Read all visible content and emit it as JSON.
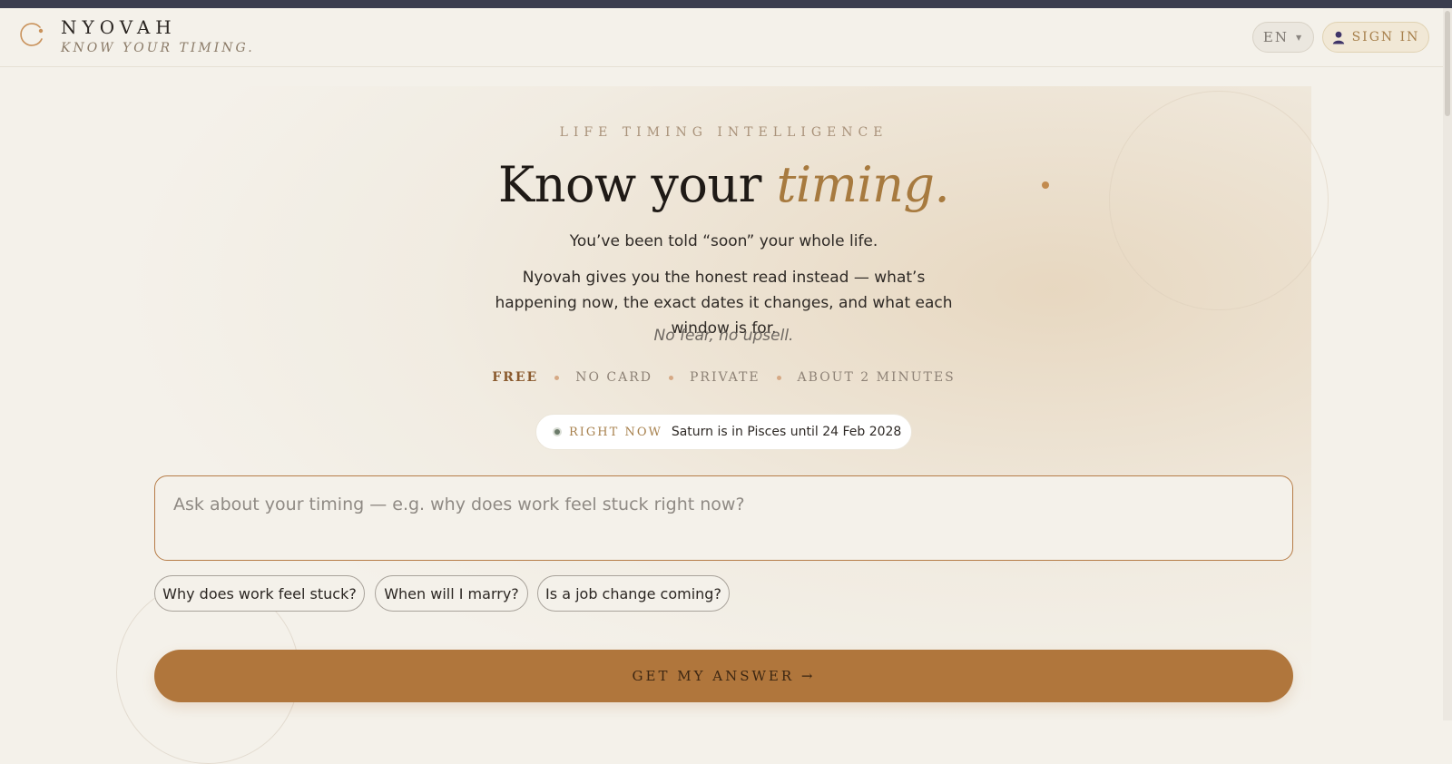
{
  "header": {
    "brand_name": "NYOVAH",
    "brand_tagline": "KNOW YOUR TIMING.",
    "language": "EN",
    "sign_in_label": "SIGN IN"
  },
  "hero": {
    "eyebrow": "LIFE TIMING INTELLIGENCE",
    "headline_prefix": "Know your ",
    "headline_accent": "timing.",
    "subtitle_line": "You’ve been told “soon” your whole life.",
    "description": "Nyovah gives you the honest read instead — what’s happening now, the exact dates it changes, and what each window is for.",
    "tagline_italic": "No fear, no upsell.",
    "features": [
      "FREE",
      "NO CARD",
      "PRIVATE",
      "ABOUT 2 MINUTES"
    ]
  },
  "right_now": {
    "label": "RIGHT NOW",
    "text": "Saturn is in Pisces until 24 Feb 2028"
  },
  "ask": {
    "placeholder": "Ask about your timing — e.g. why does work feel stuck right now?",
    "value": "",
    "suggestions": [
      "Why does work feel stuck?",
      "When will I marry?",
      "Is a job change coming?"
    ],
    "submit_label": "GET MY ANSWER →"
  },
  "colors": {
    "accent": "#b0763c",
    "accent_text": "#a77a3f",
    "background": "#f4f1ea",
    "top_strip": "#3a3d4e"
  },
  "icons": {
    "logo": "crescent-orbit-icon",
    "language_caret": "caret-down-icon",
    "sign_in": "user-icon",
    "status": "status-dot-icon"
  }
}
